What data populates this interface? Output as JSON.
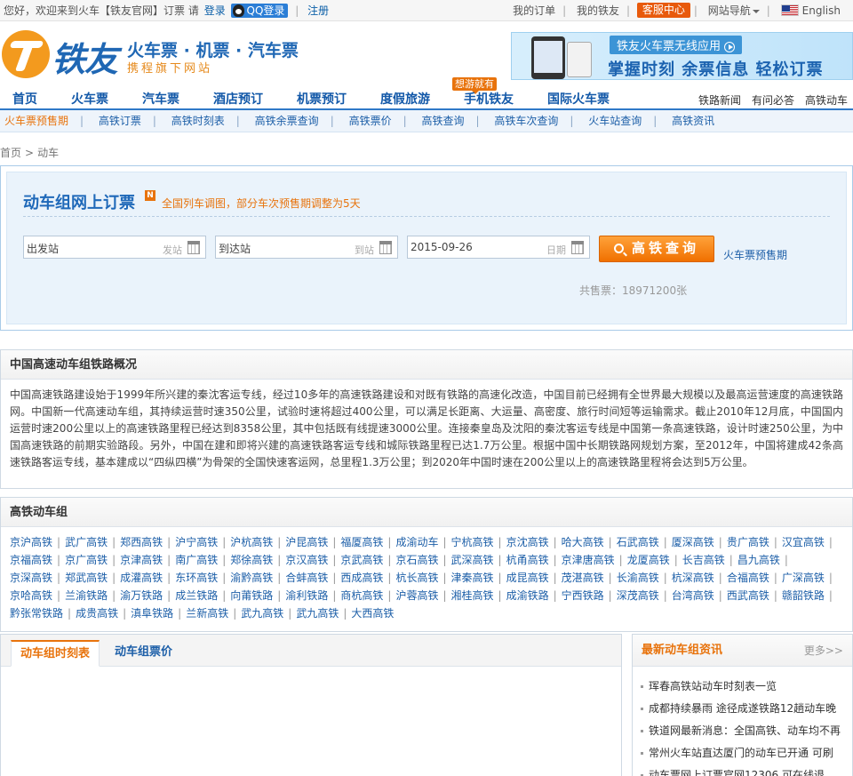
{
  "topbar": {
    "greeting": "您好，欢迎来到火车【铁友官网】订票",
    "please": "请",
    "login": "登录",
    "qq_login": "QQ登录",
    "register": "注册",
    "my_orders": "我的订单",
    "my_tieyou": "我的铁友",
    "service": "客服中心",
    "site_nav": "网站导航",
    "language": "English"
  },
  "header": {
    "logo_text": "铁友",
    "slogan": "火车票 · 机票 · 汽车票",
    "subslogan": "携程旗下网站",
    "banner_title": "铁友火车票无线应用",
    "banner_sub": "掌握时刻  余票信息  轻松订票"
  },
  "mainnav": {
    "items": [
      "首页",
      "火车票",
      "汽车票",
      "酒店预订",
      "机票预订",
      "度假旅游",
      "手机铁友",
      "国际火车票"
    ],
    "hot_tag": "想游就有",
    "right_links": [
      "铁路新闻",
      "有问必答",
      "高铁动车"
    ]
  },
  "subnav": {
    "items": [
      "火车票预售期",
      "高铁订票",
      "高铁时刻表",
      "高铁余票查询",
      "高铁票价",
      "高铁查询",
      "高铁车次查询",
      "火车站查询",
      "高铁资讯"
    ]
  },
  "breadcrumb": {
    "home": "首页",
    "current": "动车"
  },
  "booking": {
    "title": "动车组网上订票",
    "notice": "全国列车调图，部分车次预售期调整为5天",
    "from_value": "出发站",
    "from_hint": "发站",
    "to_value": "到达站",
    "to_hint": "到站",
    "date_value": "2015-09-26",
    "date_hint": "日期",
    "search_label": "高铁查询",
    "presale_link": "火车票预售期",
    "sold": "共售票：18971200张"
  },
  "overview": {
    "title": "中国高速动车组铁路概况",
    "text": "中国高速铁路建设始于1999年所兴建的秦沈客运专线，经过10多年的高速铁路建设和对既有铁路的高速化改造，中国目前已经拥有全世界最大规模以及最高运营速度的高速铁路网。中国新一代高速动车组，其持续运营时速350公里，试验时速将超过400公里，可以满足长距离、大运量、高密度、旅行时间短等运输需求。截止2010年12月底，中国国内运营时速200公里以上的高速铁路里程已经达到8358公里，其中包括既有线提速3000公里。连接秦皇岛及沈阳的秦沈客运专线是中国第一条高速铁路，设计时速250公里，为中国高速铁路的前期实验路段。另外，中国在建和即将兴建的高速铁路客运专线和城际铁路里程已达1.7万公里。根据中国中长期铁路网规划方案，至2012年，中国将建成42条高速铁路客运专线，基本建成以“四纵四横”为骨架的全国快速客运网，总里程1.3万公里；到2020年中国时速在200公里以上的高速铁路里程将会达到5万公里。"
  },
  "lines": {
    "title": "高铁动车组",
    "items": [
      "京沪高铁",
      "武广高铁",
      "郑西高铁",
      "沪宁高铁",
      "沪杭高铁",
      "沪昆高铁",
      "福厦高铁",
      "成渝动车",
      "宁杭高铁",
      "京沈高铁",
      "哈大高铁",
      "石武高铁",
      "厦深高铁",
      "贵广高铁",
      "汉宜高铁",
      "京福高铁",
      "京广高铁",
      "京津高铁",
      "南广高铁",
      "郑徐高铁",
      "京汉高铁",
      "京武高铁",
      "京石高铁",
      "武深高铁",
      "杭甬高铁",
      "京津唐高铁",
      "龙厦高铁",
      "长吉高铁",
      "昌九高铁",
      "京深高铁",
      "郑武高铁",
      "成灌高铁",
      "东环高铁",
      "渝黔高铁",
      "合蚌高铁",
      "西成高铁",
      "杭长高铁",
      "津秦高铁",
      "成昆高铁",
      "茂湛高铁",
      "长渝高铁",
      "杭深高铁",
      "合福高铁",
      "广深高铁",
      "京哈高铁",
      "兰渝铁路",
      "渝万铁路",
      "成兰铁路",
      "向莆铁路",
      "渝利铁路",
      "商杭高铁",
      "沪蓉高铁",
      "湘桂高铁",
      "成渝铁路",
      "宁西铁路",
      "深茂高铁",
      "台湾高铁",
      "西武高铁",
      "赣韶铁路",
      "黔张常铁路",
      "成贵高铁",
      "滇阜铁路",
      "兰新高铁",
      "武九高铁",
      "武九高铁",
      "大西高铁"
    ]
  },
  "tabs": {
    "items": [
      "动车组时刻表",
      "动车组票价"
    ]
  },
  "news": {
    "title": "最新动车组资讯",
    "more": "更多>>",
    "items": [
      "珲春高铁站动车时刻表一览",
      "成都持续暴雨 途径成遂铁路12趟动车晚",
      "铁道网最新消息：全国高铁、动车均不再",
      "常州火车站直达厦门的动车已开通 可刷",
      "动车票网上订票官网12306 可在线退"
    ]
  }
}
